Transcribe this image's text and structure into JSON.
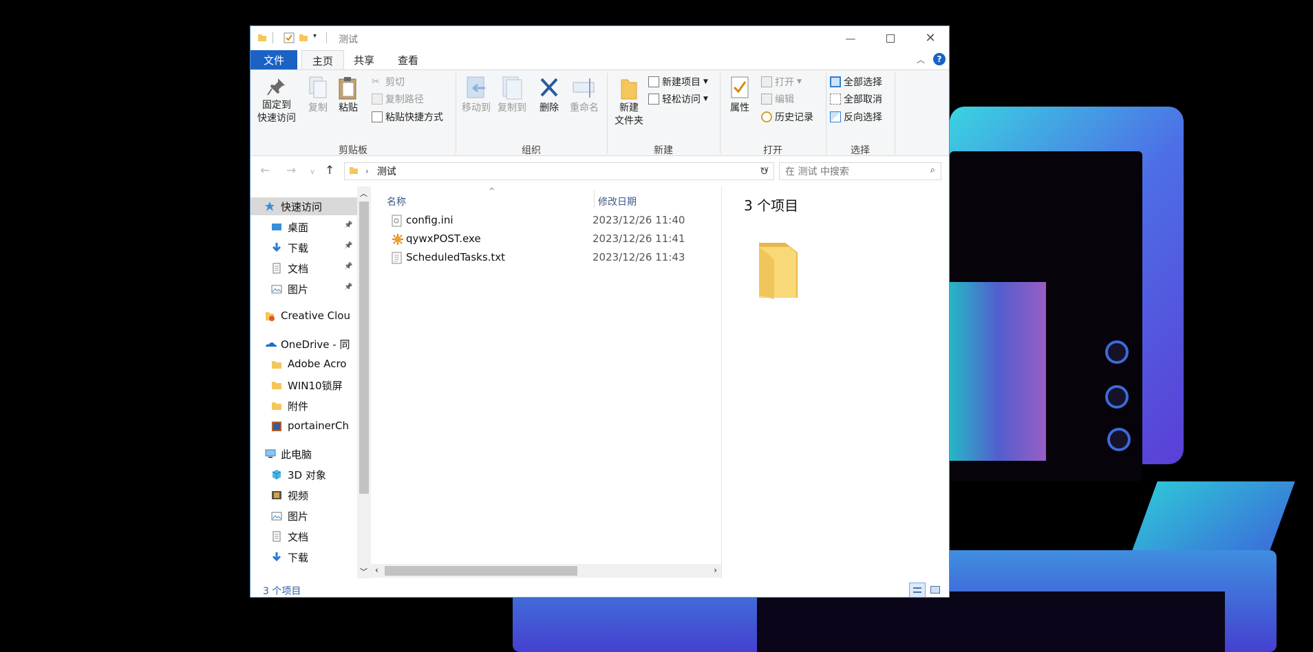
{
  "window": {
    "title": "测试"
  },
  "ribbon": {
    "tabs": [
      "文件",
      "主页",
      "共享",
      "查看"
    ],
    "clipboard": {
      "pin_line1": "固定到",
      "pin_line2": "快速访问",
      "copy": "复制",
      "paste": "粘贴",
      "cut": "剪切",
      "copy_path": "复制路径",
      "paste_shortcut": "粘贴快捷方式",
      "label": "剪贴板"
    },
    "organize": {
      "move_to": "移动到",
      "copy_to": "复制到",
      "delete": "删除",
      "rename": "重命名",
      "label": "组织"
    },
    "new": {
      "new_folder_line1": "新建",
      "new_folder_line2": "文件夹",
      "new_item": "新建项目",
      "easy_access": "轻松访问",
      "label": "新建"
    },
    "open": {
      "properties": "属性",
      "open": "打开",
      "edit": "编辑",
      "history": "历史记录",
      "label": "打开"
    },
    "select": {
      "select_all": "全部选择",
      "select_none": "全部取消",
      "invert": "反向选择",
      "label": "选择"
    }
  },
  "address": {
    "path": "测试",
    "search_placeholder": "在 测试 中搜索"
  },
  "nav": {
    "items": [
      {
        "label": "快速访问",
        "icon": "star-icon"
      },
      {
        "label": "桌面",
        "icon": "desktop-icon"
      },
      {
        "label": "下载",
        "icon": "download-icon"
      },
      {
        "label": "文档",
        "icon": "document-icon"
      },
      {
        "label": "图片",
        "icon": "pictures-icon"
      },
      {
        "label": "Creative Clou",
        "icon": "creative-cloud-icon"
      },
      {
        "label": "OneDrive - 同",
        "icon": "onedrive-icon"
      },
      {
        "label": "Adobe Acro",
        "icon": "folder-icon"
      },
      {
        "label": "WIN10锁屏",
        "icon": "folder-icon"
      },
      {
        "label": "附件",
        "icon": "folder-icon"
      },
      {
        "label": "portainerCh",
        "icon": "image-file-icon"
      },
      {
        "label": "此电脑",
        "icon": "computer-icon"
      },
      {
        "label": "3D 对象",
        "icon": "cube-icon"
      },
      {
        "label": "视频",
        "icon": "video-icon"
      },
      {
        "label": "图片",
        "icon": "pictures-icon"
      },
      {
        "label": "文档",
        "icon": "document-icon"
      },
      {
        "label": "下载",
        "icon": "download-icon"
      }
    ]
  },
  "files": {
    "col_name": "名称",
    "col_date": "修改日期",
    "rows": [
      {
        "name": "config.ini",
        "date": "2023/12/26 11:40",
        "icon": "ini-file-icon"
      },
      {
        "name": "qywxPOST.exe",
        "date": "2023/12/26 11:41",
        "icon": "exe-file-icon"
      },
      {
        "name": "ScheduledTasks.txt",
        "date": "2023/12/26 11:43",
        "icon": "txt-file-icon"
      }
    ]
  },
  "preview": {
    "count": "3 个项目"
  },
  "status": {
    "count": "3 个项目"
  },
  "colors": {
    "accent": "#1a62c4",
    "folder": "#f5c75a"
  }
}
